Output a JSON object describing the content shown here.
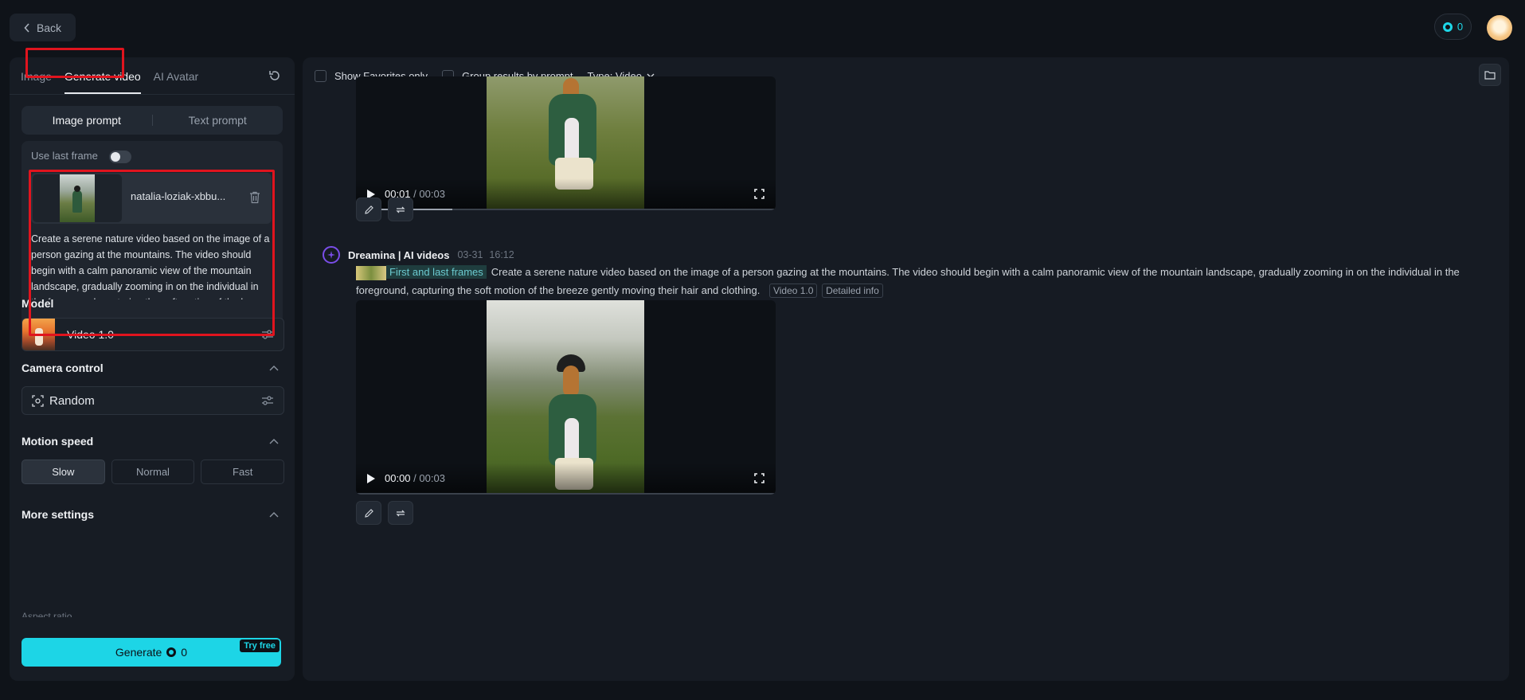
{
  "topbar": {
    "back_label": "Back",
    "credits": "0"
  },
  "left": {
    "tabs": [
      {
        "label": "Image"
      },
      {
        "label": "Generate video"
      },
      {
        "label": "AI Avatar"
      }
    ],
    "prompt_modes": {
      "image": "Image prompt",
      "text": "Text prompt"
    },
    "use_last_frame_label": "Use last frame",
    "file_name": "natalia-loziak-xbbu...",
    "prompt_text": "Create a serene nature video based on the image of a person gazing at the mountains. The video should begin with a calm panoramic view of the mountain landscape, gradually zooming in on the individual in the foreground, capturing the soft motion of the breeze gently moving their hair and clothing.",
    "model_label": "Model",
    "model_name": "Video 1.0",
    "camera_label": "Camera control",
    "camera_value": "Random",
    "motion_label": "Motion speed",
    "speeds": [
      {
        "label": "Slow"
      },
      {
        "label": "Normal"
      },
      {
        "label": "Fast"
      }
    ],
    "speed_selected": "Slow",
    "more_label": "More settings",
    "aspect_label": "Aspect ratio",
    "generate_label": "Generate",
    "generate_cost": "0",
    "try_free": "Try free"
  },
  "right": {
    "show_favorites": "Show Favorites only",
    "group_results": "Group results by prompt",
    "type_filter": "Type: Video",
    "video1": {
      "time": "00:01",
      "duration": "/ 00:03",
      "progress": 0.23
    },
    "generation": {
      "brand": "Dreamina | AI videos",
      "date": "03-31",
      "time": "16:12",
      "frames_tag": "First and last frames",
      "description": "Create a serene nature video based on the image of a person gazing at the mountains. The video should begin with a calm panoramic view of the mountain landscape, gradually zooming in on the individual in the foreground, capturing the soft motion of the breeze gently moving their hair and clothing.",
      "chip_model": "Video 1.0",
      "chip_info": "Detailed info"
    },
    "video2": {
      "time": "00:00",
      "duration": "/ 00:03",
      "progress": 0.0
    }
  },
  "colors": {
    "accent": "#1dd5e6",
    "highlight": "#e0141e",
    "brand": "#7a4de8"
  }
}
